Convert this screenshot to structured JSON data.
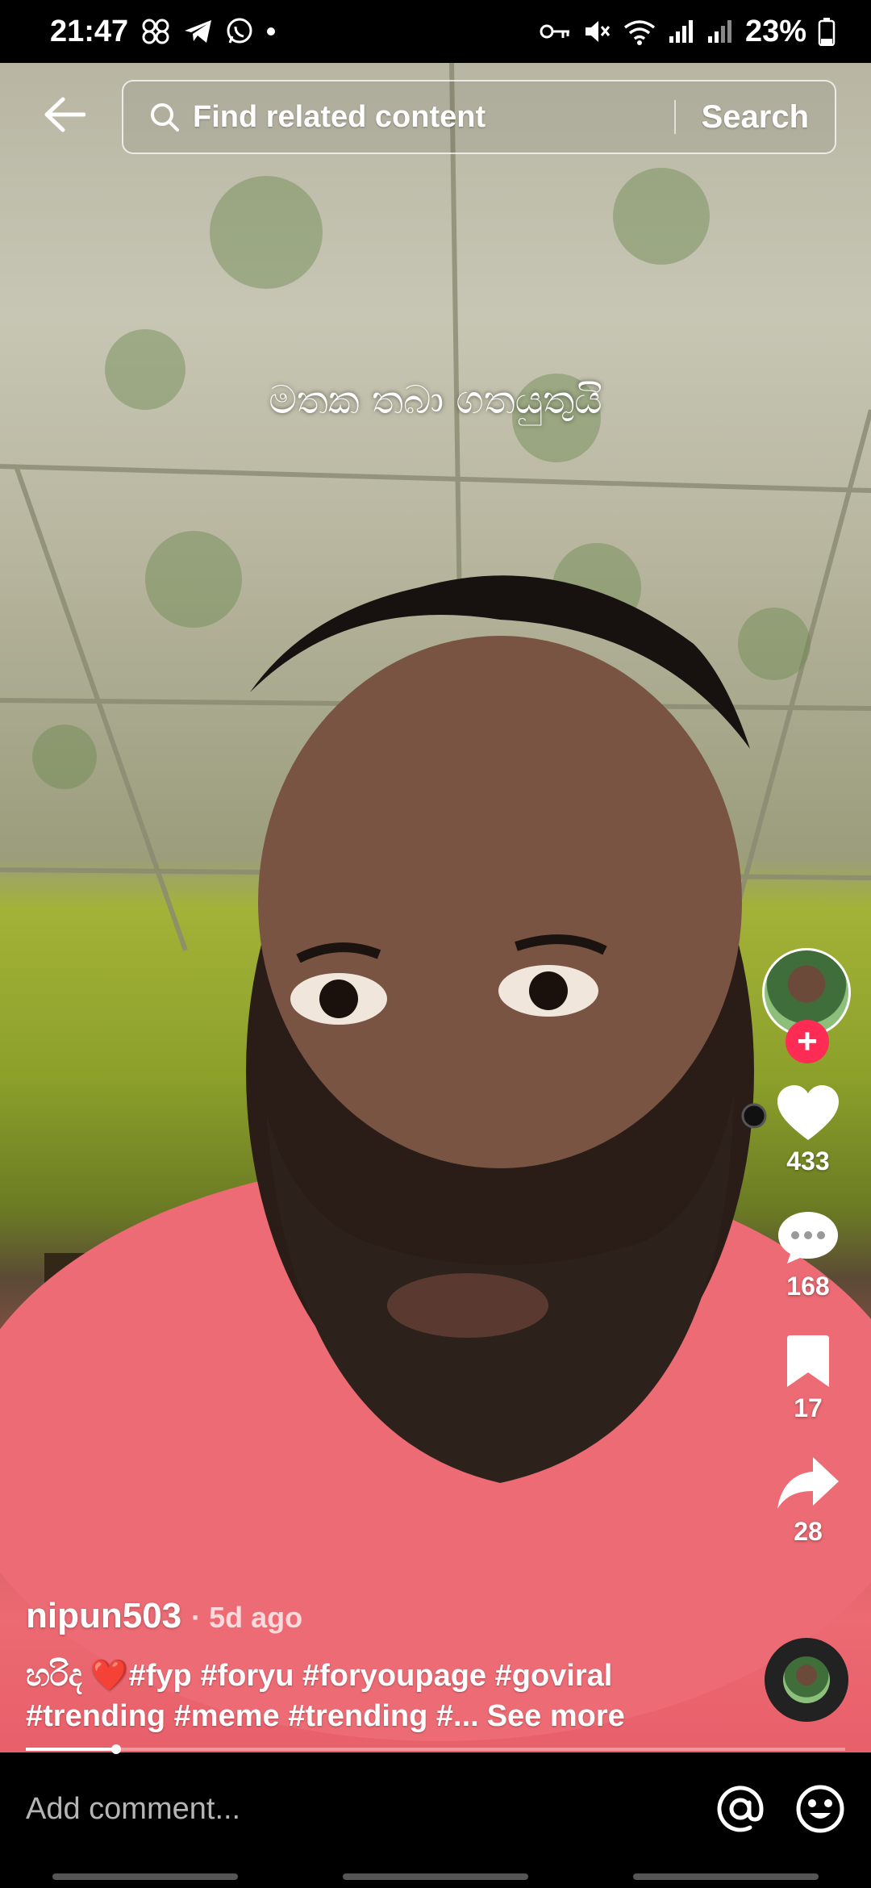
{
  "status_bar": {
    "time": "21:47",
    "battery": "23%",
    "left_icons": [
      "infinity-icon",
      "telegram-icon",
      "whatsapp-icon",
      "dot-icon"
    ],
    "right_icons": [
      "key-icon",
      "mute-icon",
      "wifi-icon",
      "signal-icon",
      "signal-icon-2",
      "battery-icon"
    ]
  },
  "top_bar": {
    "search_placeholder": "Find related content",
    "search_button": "Search"
  },
  "video": {
    "caption_overlay": "මතක තබා ගතයුතුයි"
  },
  "actions": {
    "likes": "433",
    "comments": "168",
    "saves": "17",
    "shares": "28"
  },
  "post": {
    "username": "nipun503",
    "time_ago": "· 5d ago",
    "description_prefix": "හරිද ",
    "heart": "❤️",
    "description_line1": "#fyp #foryu #foryoupage #goviral",
    "description_line2": "#trending #meme #trending #...",
    "see_more": "See more",
    "progress": 0.11
  },
  "comment_bar": {
    "placeholder": "Add comment..."
  },
  "colors": {
    "accent": "#fe2c55"
  }
}
